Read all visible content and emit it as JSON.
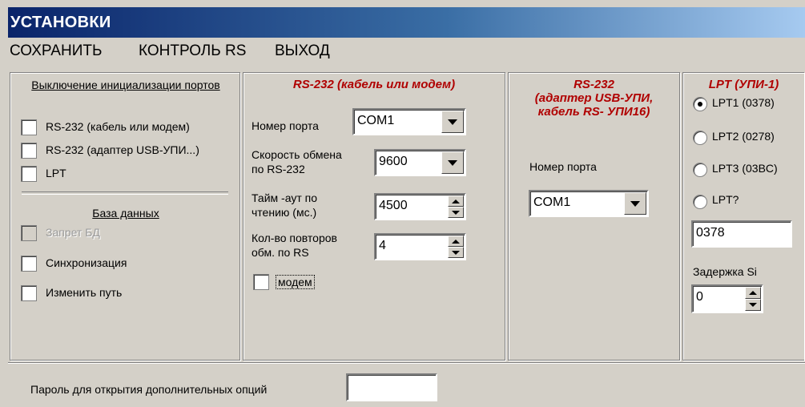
{
  "window": {
    "title": "УСТАНОВКИ"
  },
  "menu": {
    "save": "СОХРАНИТЬ",
    "rs_control": "КОНТРОЛЬ RS",
    "exit": "ВЫХОД"
  },
  "init_group": {
    "heading": "Выключение инициализации портов",
    "options": [
      {
        "label": "RS-232 (кабель или модем)",
        "checked": false
      },
      {
        "label": "RS-232 (адаптер USB-УПИ...)",
        "checked": false
      },
      {
        "label": "LPT",
        "checked": false
      }
    ],
    "db_heading": "База данных",
    "db_options": [
      {
        "label": "Запрет БД",
        "checked": false,
        "disabled": true
      },
      {
        "label": "Синхронизация",
        "checked": false
      },
      {
        "label": "Изменить путь",
        "checked": false
      }
    ]
  },
  "rs232_cable": {
    "heading": "RS-232 (кабель или модем)",
    "port_label": "Номер порта",
    "port_value": "COM1",
    "speed_label_1": "Скорость обмена",
    "speed_label_2": "по RS-232",
    "speed_value": "9600",
    "timeout_label_1": "Тайм -аут по",
    "timeout_label_2": "чтению (мс.)",
    "timeout_value": "4500",
    "retries_label_1": "Кол-во повторов",
    "retries_label_2": "обм. по RS",
    "retries_value": "4",
    "modem_label": "модем",
    "modem_checked": false
  },
  "rs232_usb": {
    "heading_1": "RS-232",
    "heading_2": "(адаптер USB-УПИ,",
    "heading_3": "кабель RS- УПИ16)",
    "port_label": "Номер порта",
    "port_value": "COM1"
  },
  "lpt": {
    "heading": "LPT (УПИ-1)",
    "options": [
      {
        "label": "LPT1  (0378)",
        "selected": true
      },
      {
        "label": "LPT2  (0278)",
        "selected": false
      },
      {
        "label": "LPT3  (03BC)",
        "selected": false
      },
      {
        "label": "LPT?",
        "selected": false
      }
    ],
    "address_value": "0378",
    "delay_label": "Задержка Si",
    "delay_value": "0"
  },
  "password": {
    "label": "Пароль для открытия дополнительных опций",
    "value": ""
  }
}
